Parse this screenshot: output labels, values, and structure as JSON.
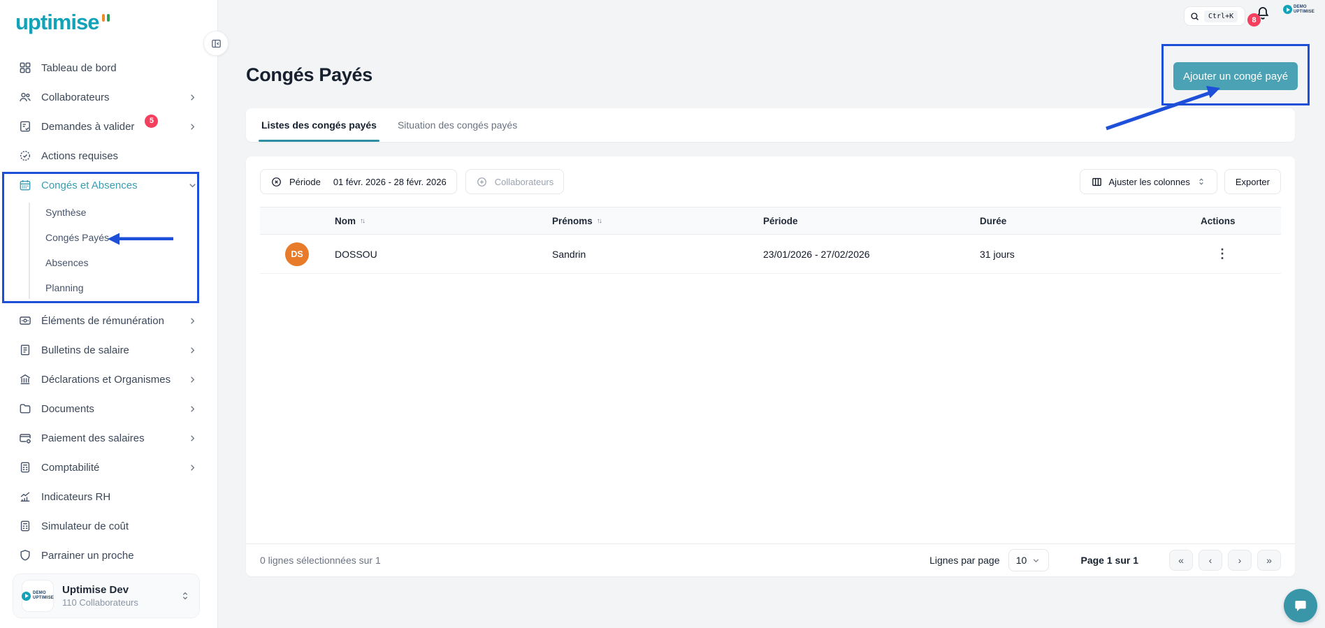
{
  "colors": {
    "brand_teal": "#12a3b8",
    "button_teal": "#4aa2b4",
    "tab_underline_teal": "#2d8fa1",
    "annotation_blue": "#1d4fd8",
    "badge_red": "#f43f5e",
    "avatar_orange": "#e87b2a",
    "background_gray": "#f2f4f6"
  },
  "sidebar": {
    "logo_text": "uptimise",
    "items": [
      {
        "label": "Tableau de bord",
        "icon": "grid-icon"
      },
      {
        "label": "Collaborateurs",
        "icon": "users-icon",
        "chevron": "right"
      },
      {
        "label": "Demandes à valider",
        "icon": "clipboard-check-icon",
        "badge": "5",
        "chevron": "right"
      },
      {
        "label": "Actions requises",
        "icon": "seal-check-icon"
      },
      {
        "label": "Congés et Absences",
        "icon": "calendar-icon",
        "chevron": "down",
        "active": true
      },
      {
        "label": "Éléments de rémunération",
        "icon": "banknote-icon",
        "chevron": "right"
      },
      {
        "label": "Bulletins de salaire",
        "icon": "payslip-icon",
        "chevron": "right"
      },
      {
        "label": "Déclarations et Organismes",
        "icon": "bank-icon",
        "chevron": "right"
      },
      {
        "label": "Documents",
        "icon": "folder-icon",
        "chevron": "right"
      },
      {
        "label": "Paiement des salaires",
        "icon": "card-gear-icon",
        "chevron": "right"
      },
      {
        "label": "Comptabilité",
        "icon": "calculator-icon",
        "chevron": "right"
      },
      {
        "label": "Indicateurs RH",
        "icon": "chart-icon"
      },
      {
        "label": "Simulateur de coût",
        "icon": "calculator-icon"
      },
      {
        "label": "Parrainer un proche",
        "icon": "shield-icon"
      }
    ],
    "submenu": [
      {
        "label": "Synthèse"
      },
      {
        "label": "Congés Payés",
        "annotated": true
      },
      {
        "label": "Absences"
      },
      {
        "label": "Planning"
      }
    ],
    "org": {
      "name": "Uptimise Dev",
      "subtitle": "110 Collaborateurs",
      "logo_line1": "DEMO",
      "logo_line2": "UPTIMISE"
    }
  },
  "header": {
    "search_shortcut": "Ctrl+K",
    "notification_count": "8",
    "avatar_line1": "DEMO",
    "avatar_line2": "UPTIMISE"
  },
  "page": {
    "title": "Congés Payés",
    "add_button_label": "Ajouter un congé payé"
  },
  "tabs": [
    {
      "label": "Listes des congés payés",
      "active": true
    },
    {
      "label": "Situation des congés payés",
      "active": false
    }
  ],
  "filters": {
    "periode_label": "Période",
    "periode_value": "01 févr. 2026 - 28 févr. 2026",
    "collaborateurs_label": "Collaborateurs",
    "adjust_columns_label": "Ajuster les colonnes",
    "export_label": "Exporter"
  },
  "table": {
    "columns": [
      "Nom",
      "Prénoms",
      "Période",
      "Durée",
      "Actions"
    ],
    "rows": [
      {
        "initials": "DS",
        "nom": "DOSSOU",
        "prenoms": "Sandrin",
        "periode": "23/01/2026 - 27/02/2026",
        "duree": "31 jours"
      }
    ]
  },
  "pagination": {
    "selection_text": "0 lignes sélectionnées sur 1",
    "rows_per_page_label": "Lignes par page",
    "rows_per_page_value": "10",
    "page_info": "Page 1 sur 1"
  },
  "icons": {
    "sort": "↑↓",
    "kebab": "⋮",
    "first": "«",
    "prev": "‹",
    "next": "›",
    "last": "»"
  }
}
